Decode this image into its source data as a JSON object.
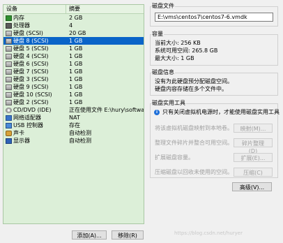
{
  "device_list": {
    "headers": {
      "device": "设备",
      "summary": "摘要"
    },
    "rows": [
      {
        "icon": "mem",
        "name": "内存",
        "summary": "2 GB"
      },
      {
        "icon": "cpu",
        "name": "处理器",
        "summary": "4"
      },
      {
        "icon": "disk",
        "name": "硬盘 (SCSI)",
        "summary": "20 GB"
      },
      {
        "icon": "disk",
        "name": "硬盘 8 (SCSI)",
        "summary": "1 GB",
        "selected": true
      },
      {
        "icon": "disk",
        "name": "硬盘 5 (SCSI)",
        "summary": "1 GB"
      },
      {
        "icon": "disk",
        "name": "硬盘 4 (SCSI)",
        "summary": "1 GB"
      },
      {
        "icon": "disk",
        "name": "硬盘 6 (SCSI)",
        "summary": "1 GB"
      },
      {
        "icon": "disk",
        "name": "硬盘 7 (SCSI)",
        "summary": "1 GB"
      },
      {
        "icon": "disk",
        "name": "硬盘 3 (SCSI)",
        "summary": "1 GB"
      },
      {
        "icon": "disk",
        "name": "硬盘 9 (SCSI)",
        "summary": "1 GB"
      },
      {
        "icon": "disk",
        "name": "硬盘 10 (SCSI)",
        "summary": "1 GB"
      },
      {
        "icon": "disk",
        "name": "硬盘 2 (SCSI)",
        "summary": "1 GB"
      },
      {
        "icon": "cd",
        "name": "CD/DVD (IDE)",
        "summary": "正在使用文件 E:\\hury\\software..."
      },
      {
        "icon": "net",
        "name": "网络适配器",
        "summary": "NAT"
      },
      {
        "icon": "usb",
        "name": "USB 控制器",
        "summary": "存在"
      },
      {
        "icon": "sound",
        "name": "声卡",
        "summary": "自动检测"
      },
      {
        "icon": "monitor",
        "name": "显示器",
        "summary": "自动检测"
      }
    ]
  },
  "buttons": {
    "add": "添加(A)...",
    "remove": "移除(R)",
    "advanced": "高级(V)..."
  },
  "disk_file": {
    "title": "磁盘文件",
    "path": "E:\\vms\\centos7\\centos7-6.vmdk"
  },
  "capacity": {
    "title": "容量",
    "current": "当前大小: 256 KB",
    "free": "系统可用空间: 265.8 GB",
    "max": "最大大小: 1 GB"
  },
  "disk_info": {
    "title": "磁盘信息",
    "line1": "没有为此硬盘预分配磁盘空间。",
    "line2": "硬盘内容存储在多个文件中。"
  },
  "utilities": {
    "title": "磁盘实用工具",
    "notice": "只有关闭虚拟机电源时，才能使用磁盘实用工具",
    "items": [
      {
        "label": "将该虚拟机磁盘映射到本地卷。",
        "button": "映射(M)..."
      },
      {
        "label": "整理文件碎片并整合可用空间。",
        "button": "碎片整理(D)"
      },
      {
        "label": "扩展磁盘容量。",
        "button": "扩展(E)..."
      },
      {
        "label": "压缩磁盘以回收未使用的空间。",
        "button": "压缩(C)"
      }
    ]
  },
  "watermark": "https://blog.csdn.net/huryer"
}
